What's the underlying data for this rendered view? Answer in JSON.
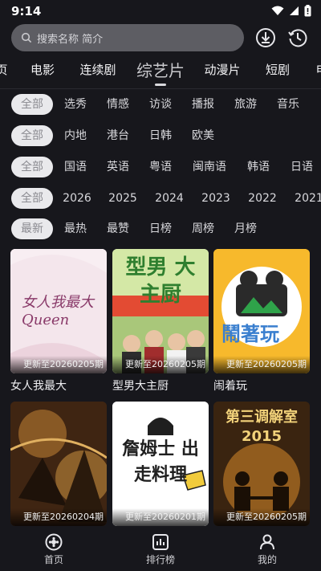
{
  "status": {
    "time": "9:14"
  },
  "search": {
    "placeholder": "搜索名称 简介"
  },
  "icons": {
    "download": "download-icon",
    "history": "history-icon"
  },
  "categories": [
    "页",
    "电影",
    "连续剧",
    "综艺片",
    "动漫片",
    "短剧",
    "电"
  ],
  "active_category": "综艺片",
  "filters": {
    "genre": [
      "全部",
      "选秀",
      "情感",
      "访谈",
      "播报",
      "旅游",
      "音乐"
    ],
    "region": [
      "全部",
      "内地",
      "港台",
      "日韩",
      "欧美"
    ],
    "language": [
      "全部",
      "国语",
      "英语",
      "粤语",
      "闽南语",
      "韩语",
      "日语"
    ],
    "year": [
      "全部",
      "2026",
      "2025",
      "2024",
      "2023",
      "2022",
      "2021"
    ],
    "sort": [
      "最新",
      "最热",
      "最赞",
      "日榜",
      "周榜",
      "月榜"
    ]
  },
  "shows": [
    {
      "title": "女人我最大",
      "update": "更新至20260205期",
      "poster_text": "女人我最大 Queen",
      "bg": "#f3e4ea"
    },
    {
      "title": "型男大主厨",
      "update": "更新至20260205期",
      "poster_text": "型男 大主厨",
      "bg": "#cfe6a0"
    },
    {
      "title": "闹着玩",
      "update": "更新至20260205期",
      "poster_text": "鬧著玩",
      "bg": "#f7b92c"
    },
    {
      "title": "",
      "update": "更新至20260204期",
      "poster_text": "",
      "bg": "#4a2c15"
    },
    {
      "title": "",
      "update": "更新至20260201期",
      "poster_text": "詹姆士 出走料理",
      "bg": "#ffffff"
    },
    {
      "title": "",
      "update": "更新至20260205期",
      "poster_text": "第三调解室 2015",
      "bg": "#3a2410"
    }
  ],
  "nav": {
    "home": "首页",
    "rank": "排行榜",
    "mine": "我的"
  }
}
